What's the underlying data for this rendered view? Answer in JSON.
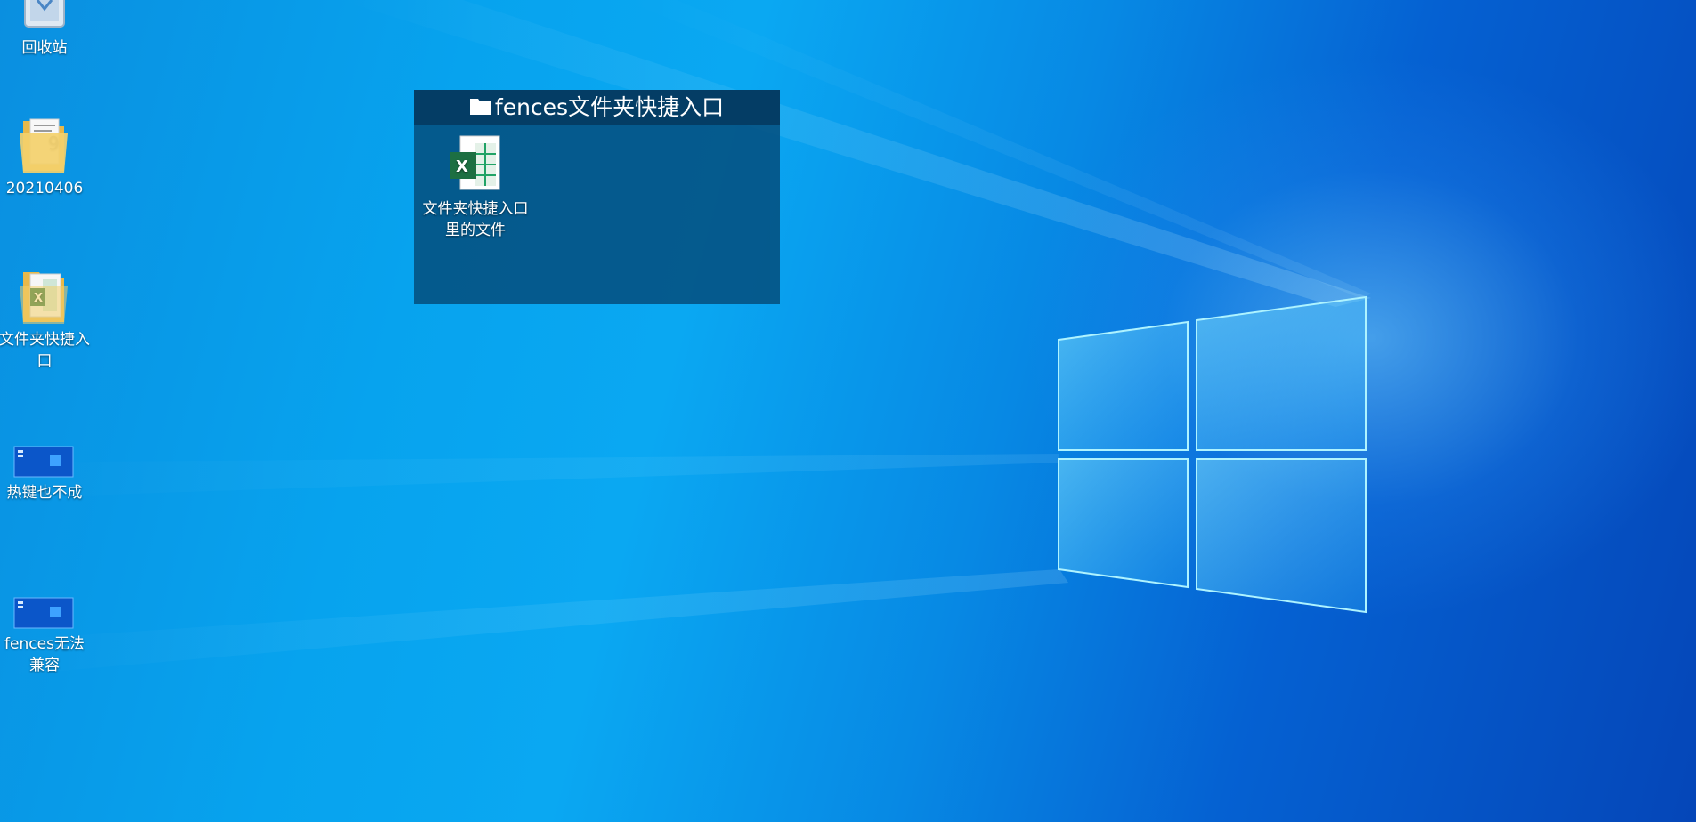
{
  "desktop_icons": [
    {
      "label": "回收站",
      "icon": "recycle-bin-icon"
    },
    {
      "label": "20210406",
      "icon": "folder-icon"
    },
    {
      "label": "文件夹快捷入口",
      "icon": "folder-excel-icon"
    },
    {
      "label": "热键也不成",
      "icon": "desktop-thumbnail-icon"
    },
    {
      "label": "fences无法兼容",
      "icon": "desktop-thumbnail-icon"
    }
  ],
  "fence": {
    "title": "fences文件夹快捷入口",
    "title_icon": "folder-icon",
    "items": [
      {
        "label": "文件夹快捷入口里的文件",
        "icon": "excel-file-icon"
      }
    ]
  },
  "colors": {
    "fence_body": "#055080",
    "fence_header": "#043a60",
    "excel_green": "#1d6f42",
    "folder_yellow": "#f3d06b"
  }
}
